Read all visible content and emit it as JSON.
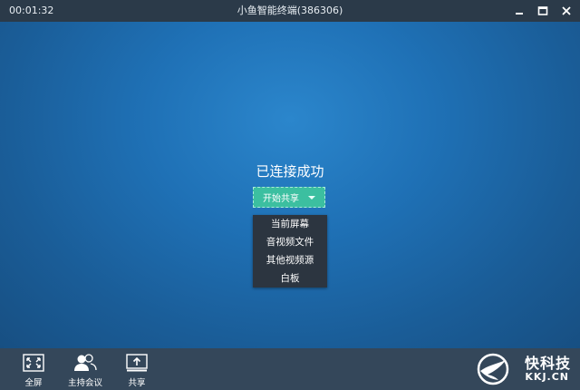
{
  "titlebar": {
    "timer": "00:01:32",
    "title": "小鱼智能终端(386306)",
    "controls": [
      "minimize-icon",
      "maximize-icon",
      "close-icon"
    ]
  },
  "main": {
    "status": "已连接成功",
    "share_button": "开始共享",
    "share_menu": [
      "当前屏幕",
      "音视频文件",
      "其他视频源",
      "白板"
    ]
  },
  "toolbar": {
    "items": [
      {
        "label": "全屏",
        "icon": "fullscreen-icon"
      },
      {
        "label": "主持会议",
        "icon": "host-meeting-icon"
      },
      {
        "label": "共享",
        "icon": "share-upload-icon"
      }
    ]
  },
  "watermark": {
    "brand": "快科技",
    "domain": "KKJ.CN",
    "icon": "swallow-logo-icon"
  },
  "colors": {
    "titlebar": "#2b3a49",
    "bottombar": "#34475a",
    "main_bg": "#1f71b6",
    "accent": "#3cbfa0",
    "menu_bg": "#2c3540"
  }
}
